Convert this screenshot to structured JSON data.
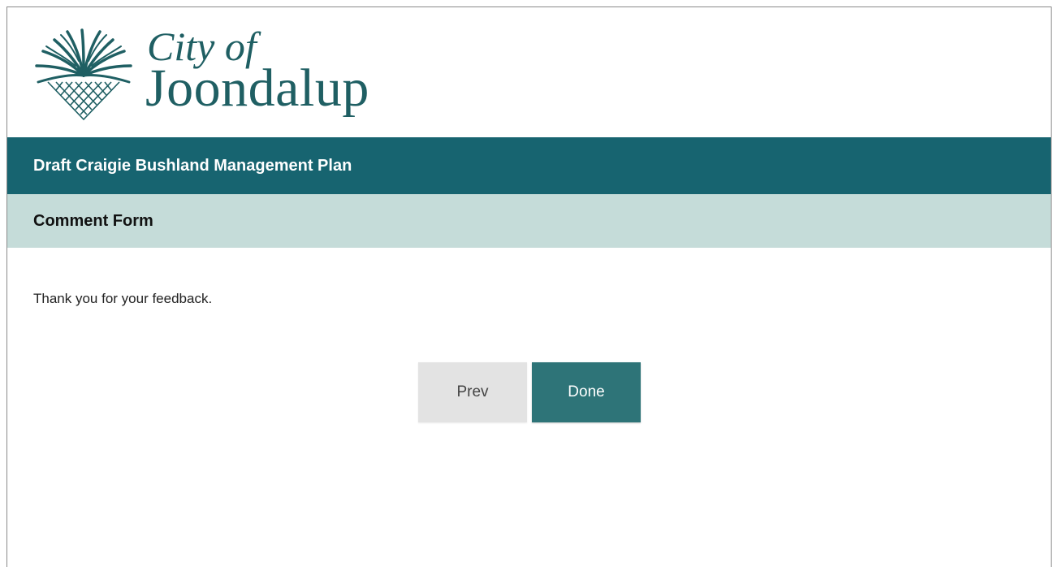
{
  "logo": {
    "line1": "City of",
    "line2": "Joondalup",
    "icon": "palm-frond-lattice-logo"
  },
  "title_bar": {
    "title": "Draft Craigie Bushland Management Plan"
  },
  "subtitle_bar": {
    "title": "Comment Form"
  },
  "main": {
    "message": "Thank you for your feedback."
  },
  "buttons": {
    "prev_label": "Prev",
    "done_label": "Done"
  },
  "colors": {
    "brand_dark_teal": "#176470",
    "brand_light_teal": "#c5dcd9",
    "done_button": "#2e7478",
    "prev_button": "#e3e3e3",
    "logo_color": "#1f5f63"
  }
}
